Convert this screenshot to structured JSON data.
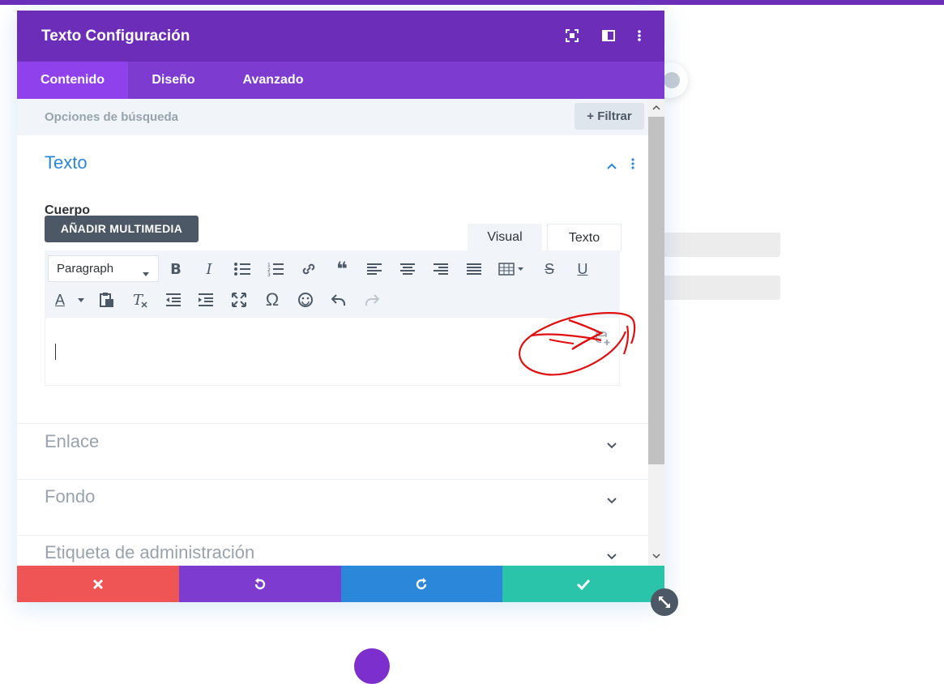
{
  "modal": {
    "title": "Texto Configuración",
    "header_icons": [
      "focus-icon",
      "split-layout-icon",
      "more-vertical-icon"
    ]
  },
  "tabs": [
    {
      "label": "Contenido",
      "active": true
    },
    {
      "label": "Diseño",
      "active": false
    },
    {
      "label": "Avanzado",
      "active": false
    }
  ],
  "search": {
    "placeholder": "Opciones de búsqueda",
    "filter_label": "Filtrar"
  },
  "sections": [
    {
      "title": "Texto",
      "open": true
    },
    {
      "title": "Enlace",
      "open": false
    },
    {
      "title": "Fondo",
      "open": false
    },
    {
      "title": "Etiqueta de administración",
      "open": false
    }
  ],
  "body_field": {
    "label": "Cuerpo",
    "media_button": "AÑADIR MULTIMEDIA",
    "mode_tabs": [
      "Visual",
      "Texto"
    ],
    "active_mode": "Visual",
    "format_select": "Paragraph",
    "editor_content": "",
    "toolbar_row1": [
      "bold-icon",
      "italic-icon",
      "bullet-list-icon",
      "numbered-list-icon",
      "link-icon",
      "blockquote-icon",
      "align-left-icon",
      "align-center-icon",
      "align-right-icon",
      "justify-icon",
      "table-icon",
      "strikethrough-icon",
      "underline-icon"
    ],
    "toolbar_row2": [
      "text-color-icon",
      "paste-text-icon",
      "clear-format-icon",
      "outdent-icon",
      "indent-icon",
      "fullscreen-icon",
      "special-char-icon",
      "emoji-icon",
      "undo-icon",
      "redo-icon"
    ]
  },
  "footer": [
    "cancel-icon",
    "undo-icon",
    "redo-icon",
    "save-check-icon"
  ],
  "colors": {
    "header": "#6c2eb9",
    "tabs": "#7e3bd0",
    "active_tab": "#8f42ec",
    "accent_blue": "#2b87da",
    "cancel": "#ef5555",
    "save": "#29c4a9"
  }
}
